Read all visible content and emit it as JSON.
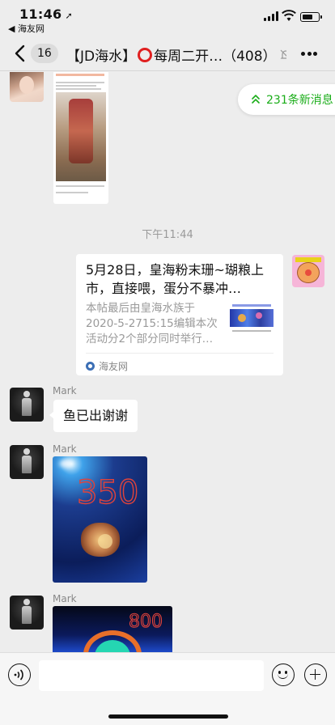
{
  "status_bar": {
    "time": "11:46",
    "back_app": "◀ 海友网"
  },
  "nav": {
    "unread_count": "16",
    "title_prefix": "【JD海水】",
    "title_suffix": "每周二开…（408）"
  },
  "chat": {
    "new_messages": "231条新消息",
    "timestamp": "下午11:44",
    "link_card": {
      "title": "5月28日，皇海粉末珊~瑚粮上市，直接喂，蛋分不暴冲…",
      "description": "本帖最后由皇海水族于 2020-5-2715:15编辑本次活动分2个部分同时举行…",
      "source": "海友网"
    },
    "messages": [
      {
        "sender": "Mark",
        "text": "鱼已出谢谢"
      },
      {
        "sender": "Mark",
        "photo_caption": "350"
      },
      {
        "sender": "Mark",
        "photo_caption": "800"
      }
    ]
  },
  "colors": {
    "accent_green": "#1aad19",
    "background": "#ededed",
    "ring_red": "#e02020"
  }
}
